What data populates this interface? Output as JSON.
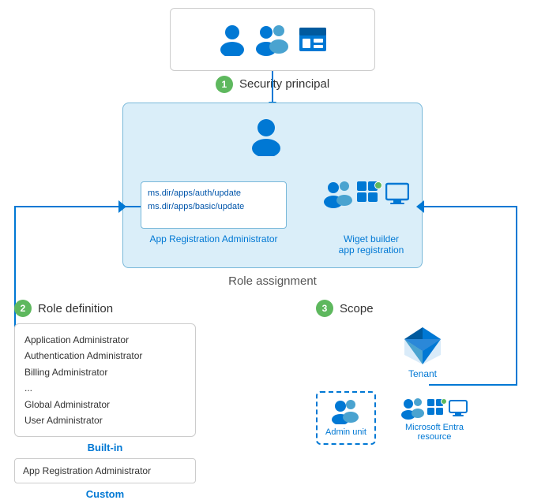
{
  "security_principal": {
    "label": "Security principal",
    "badge": "1"
  },
  "role_assignment": {
    "label": "Role assignment",
    "permissions": [
      "ms.dir/apps/auth/update",
      "ms.dir/apps/basic/update"
    ],
    "app_reg_label": "App Registration Administrator",
    "widget_label": "Wiget builder\napp registration"
  },
  "role_definition": {
    "badge": "2",
    "title": "Role definition",
    "builtin_roles": [
      "Application Administrator",
      "Authentication Administrator",
      "Billing Administrator",
      "...",
      "Global Administrator",
      "User Administrator"
    ],
    "builtin_label": "Built-in",
    "custom_role": "App Registration Administrator",
    "custom_label": "Custom"
  },
  "scope": {
    "badge": "3",
    "title": "Scope",
    "tenant_label": "Tenant",
    "admin_unit_label": "Admin unit",
    "ms_entra_label": "Microsoft Entra\nresource"
  },
  "colors": {
    "blue": "#0078d4",
    "light_blue_bg": "#daeef9",
    "border_blue": "#79b8d9",
    "green_badge": "#5eb85e",
    "text_blue": "#0055aa"
  }
}
